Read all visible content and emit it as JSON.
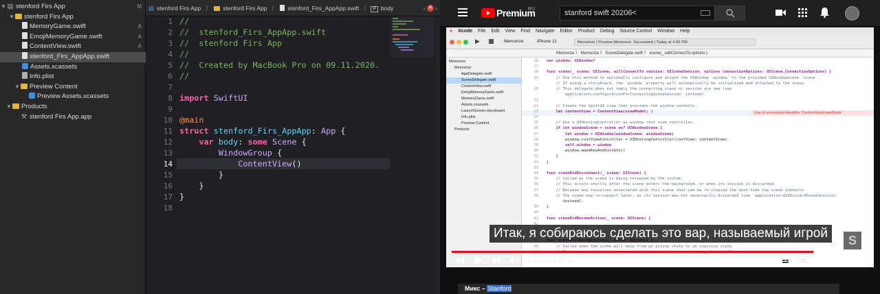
{
  "navigator": {
    "project": "stenford Firs App",
    "project_status": "M",
    "group": "stenford Firs App",
    "files": [
      {
        "name": "MemoryGame.swift",
        "status": "A"
      },
      {
        "name": "EmojiMemoryGame.swift",
        "status": "A"
      },
      {
        "name": "ContentView.swift",
        "status": "A"
      },
      {
        "name": "stenford_Firs_AppApp.swift",
        "status": ""
      },
      {
        "name": "Assets.xcassets",
        "status": ""
      },
      {
        "name": "Info.plist",
        "status": ""
      }
    ],
    "preview_group": "Preview Content",
    "preview_assets": "Preview Assets.xcassets",
    "products_group": "Products",
    "product_app": "stenford Firs App.app"
  },
  "jumpbar": {
    "crumbs": [
      "stenford Firs App",
      "stenford Firs App",
      "stenford_Firs_AppApp.swift",
      "body"
    ]
  },
  "editor": {
    "current_line": 14,
    "lines": [
      {
        "n": "1",
        "t": "//"
      },
      {
        "n": "2",
        "t": "//  stenford_Firs_AppApp.swift"
      },
      {
        "n": "3",
        "t": "//  stenford Firs App"
      },
      {
        "n": "4",
        "t": "//"
      },
      {
        "n": "5",
        "t": "//  Created by MacBook Pro on 09.11.2020."
      },
      {
        "n": "6",
        "t": "//"
      },
      {
        "n": "7",
        "t": ""
      },
      {
        "n": "8",
        "t": "import SwiftUI"
      },
      {
        "n": "9",
        "t": ""
      },
      {
        "n": "10",
        "t": "@main"
      },
      {
        "n": "11",
        "t": "struct stenford_Firs_AppApp: App {"
      },
      {
        "n": "12",
        "t": "    var body: some Scene {"
      },
      {
        "n": "13",
        "t": "        WindowGroup {"
      },
      {
        "n": "14",
        "t": "            ContentView()"
      },
      {
        "n": "15",
        "t": "        }"
      },
      {
        "n": "16",
        "t": "    }"
      },
      {
        "n": "17",
        "t": "}"
      },
      {
        "n": "18",
        "t": ""
      }
    ]
  },
  "youtube": {
    "logo": "Premium",
    "region": "RU",
    "search_value": "stanford swift 20206<",
    "subtitle": "Итак, я собираюсь сделать это вар, называемый игрой",
    "time_current": "1:30:09",
    "time_total": "1:43:52",
    "progress": 0.868,
    "mix_prefix": "Микс –",
    "mix_title": "Stanford",
    "colors": {
      "accent": "#ff0000"
    }
  },
  "video_frame": {
    "mac_menu": [
      "Xcode",
      "File",
      "Edit",
      "View",
      "Find",
      "Navigate",
      "Editor",
      "Product",
      "Debug",
      "Source Control",
      "Window",
      "Help"
    ],
    "scheme": "Memorize",
    "device": "iPhone 11",
    "status": "Memorize | Preview Memorize: Succeeded | Today at 4:35 PM",
    "jump": "Memorize 〉 Memorize 〉 SceneDelegate.swift 〉 scene(_:willConnectTo:options:)",
    "nav_items": [
      "Memorize",
      "Memorize",
      "AppDelegate.swift",
      "SceneDelegate.swift",
      "ContentView.swift",
      "EmojiMemoryGame.swift",
      "MemoryGame.swift",
      "Assets.xcassets",
      "LaunchScreen.storyboard",
      "Info.plist",
      "Preview Content",
      "Products"
    ],
    "error": "Use of unresolved identifier 'ContentView(viewMode'",
    "code": [
      {
        "n": "16",
        "t": "var window: UIWindow?"
      },
      {
        "n": "17",
        "t": ""
      },
      {
        "n": "18",
        "t": "func scene(_ scene: UIScene, willConnectTo session: UISceneSession, options connectionOptions: UIScene.ConnectionOptions) {"
      },
      {
        "n": "19",
        "t": "    // Use this method to optionally configure and attach the UIWindow `window` to the provided UIWindowScene `scene`."
      },
      {
        "n": "",
        "t": "    // If using a storyboard, the `window` property will automatically be initialized and attached to the scene."
      },
      {
        "n": "20",
        "t": "    // This delegate does not imply the connecting scene or session are new (see"
      },
      {
        "n": "",
        "t": "       `application:configurationForConnectingSceneSession` instead)."
      },
      {
        "n": "21",
        "t": ""
      },
      {
        "n": "22",
        "t": "    // Create the SwiftUI view that provides the window contents."
      },
      {
        "n": "23",
        "t": "    let contentView = ContentView(viewModel: )"
      },
      {
        "n": "24",
        "t": ""
      },
      {
        "n": "25",
        "t": "    // Use a UIHostingController as window root view controller."
      },
      {
        "n": "26",
        "t": "    if let windowScene = scene as? UIWindowScene {"
      },
      {
        "n": "27",
        "t": "        let window = UIWindow(windowScene: windowScene)"
      },
      {
        "n": "28",
        "t": "        window.rootViewController = UIHostingController(rootView: contentView)"
      },
      {
        "n": "29",
        "t": "        self.window = window"
      },
      {
        "n": "30",
        "t": "        window.makeKeyAndVisible()"
      },
      {
        "n": "31",
        "t": "    }"
      },
      {
        "n": "32",
        "t": "}"
      },
      {
        "n": "33",
        "t": ""
      },
      {
        "n": "34",
        "t": "func sceneDidDisconnect(_ scene: UIScene) {"
      },
      {
        "n": "35",
        "t": "    // Called as the scene is being released by the system."
      },
      {
        "n": "36",
        "t": "    // This occurs shortly after the scene enters the background, or when its session is discarded."
      },
      {
        "n": "37",
        "t": "    // Release any resources associated with this scene that can be re-created the next time the scene connects."
      },
      {
        "n": "38",
        "t": "    // The scene may re-connect later, as its session was not necessarily discarded (see `application:didDiscardSceneSessions`"
      },
      {
        "n": "",
        "t": "       instead)."
      },
      {
        "n": "39",
        "t": "}"
      },
      {
        "n": "40",
        "t": ""
      },
      {
        "n": "41",
        "t": "func sceneDidBecomeActive(_ scene: UIScene) {"
      },
      {
        "n": "42",
        "t": ""
      },
      {
        "n": "43",
        "t": ""
      },
      {
        "n": "44",
        "t": ""
      },
      {
        "n": "45",
        "t": "func sceneWillResignActive(_ scene: UIScene) {"
      },
      {
        "n": "46",
        "t": "    // Called when the scene will move from an active state to an inactive state."
      },
      {
        "n": "47",
        "t": "    // This may occur due to temporary interruptions (ex. an incoming phone call)."
      }
    ]
  }
}
